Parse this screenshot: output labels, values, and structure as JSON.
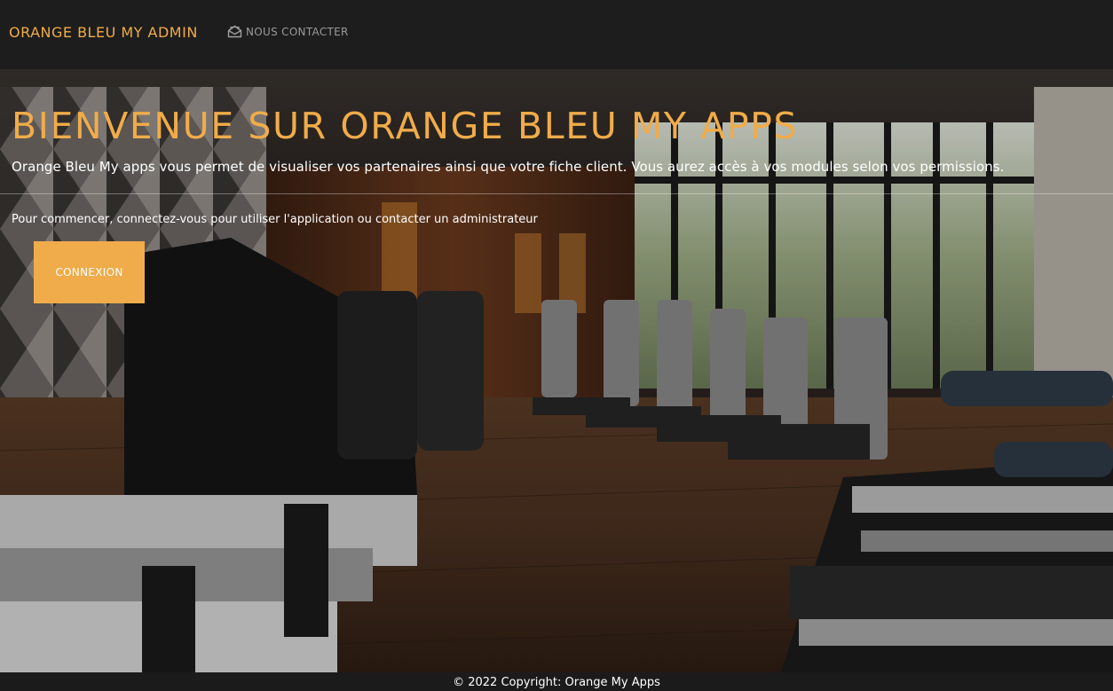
{
  "navbar": {
    "brand": "ORANGE BLEU MY ADMIN",
    "contact_label": "NOUS CONTACTER",
    "contact_icon": "envelope-open-icon"
  },
  "hero": {
    "title": "BIENVENUE SUR ORANGE BLEU MY APPS",
    "lead": "Orange Bleu My apps vous permet de visualiser vos partenaires ainsi que votre fiche client. Vous aurez accès à vos modules selon vos permissions.",
    "sub": "Pour commencer, connectez-vous pour utiliser l'application ou contacter un administrateur",
    "button_label": "CONNEXION",
    "background": "gym-interior-photo"
  },
  "footer": {
    "copyright": "© 2022 Copyright: Orange My Apps"
  },
  "colors": {
    "accent": "#f0ac4a",
    "navbar_bg": "#1d1d1d",
    "footer_bg": "#1b1b1b"
  }
}
